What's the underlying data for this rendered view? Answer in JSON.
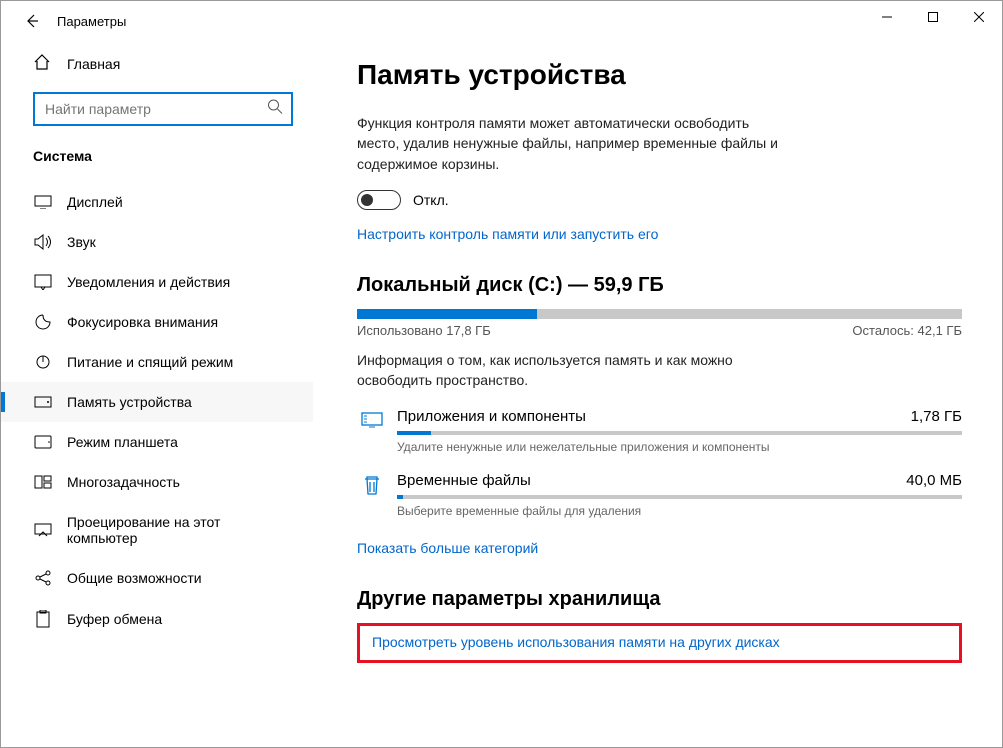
{
  "window": {
    "title": "Параметры"
  },
  "sidebar": {
    "home_label": "Главная",
    "search_placeholder": "Найти параметр",
    "section_label": "Система",
    "items": [
      {
        "label": "Дисплей"
      },
      {
        "label": "Звук"
      },
      {
        "label": "Уведомления и действия"
      },
      {
        "label": "Фокусировка внимания"
      },
      {
        "label": "Питание и спящий режим"
      },
      {
        "label": "Память устройства"
      },
      {
        "label": "Режим планшета"
      },
      {
        "label": "Многозадачность"
      },
      {
        "label": "Проецирование на этот компьютер"
      },
      {
        "label": "Общие возможности"
      },
      {
        "label": "Буфер обмена"
      }
    ]
  },
  "main": {
    "title": "Память устройства",
    "storage_sense_desc": "Функция контроля памяти может автоматически освободить место, удалив ненужные файлы, например временные файлы и содержимое корзины.",
    "toggle_state": "Откл.",
    "configure_link": "Настроить контроль памяти или запустить его",
    "disk_title": "Локальный диск (C:) — 59,9 ГБ",
    "used_label": "Использовано 17,8 ГБ",
    "free_label": "Осталось: 42,1 ГБ",
    "used_percent": 29.7,
    "disk_info": "Информация о том, как используется память и как можно освободить пространство.",
    "categories": [
      {
        "name": "Приложения и компоненты",
        "size": "1,78 ГБ",
        "sub": "Удалите ненужные или нежелательные приложения и компоненты",
        "fill": 6
      },
      {
        "name": "Временные файлы",
        "size": "40,0 МБ",
        "sub": "Выберите временные файлы для удаления",
        "fill": 1
      }
    ],
    "more_link": "Показать больше категорий",
    "other_title": "Другие параметры хранилища",
    "other_link": "Просмотреть уровень использования памяти на других дисках"
  }
}
